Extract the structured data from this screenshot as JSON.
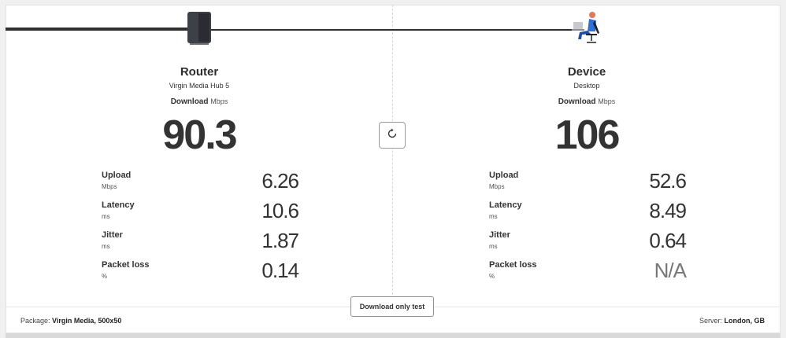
{
  "router": {
    "name": "Router",
    "model": "Virgin Media Hub 5",
    "download_label": "Download",
    "download_unit": "Mbps",
    "download_value": "90.3",
    "metrics": [
      {
        "label": "Upload",
        "unit": "Mbps",
        "value": "6.26"
      },
      {
        "label": "Latency",
        "unit": "ms",
        "value": "10.6"
      },
      {
        "label": "Jitter",
        "unit": "ms",
        "value": "1.87"
      },
      {
        "label": "Packet loss",
        "unit": "%",
        "value": "0.14"
      }
    ]
  },
  "device": {
    "name": "Device",
    "type": "Desktop",
    "download_label": "Download",
    "download_unit": "Mbps",
    "download_value": "106",
    "metrics": [
      {
        "label": "Upload",
        "unit": "Mbps",
        "value": "52.6"
      },
      {
        "label": "Latency",
        "unit": "ms",
        "value": "8.49"
      },
      {
        "label": "Jitter",
        "unit": "ms",
        "value": "0.64"
      },
      {
        "label": "Packet loss",
        "unit": "%",
        "value": "N/A"
      }
    ]
  },
  "actions": {
    "refresh_icon": "refresh-icon",
    "download_only_label": "Download only test"
  },
  "footer": {
    "package_label": "Package:",
    "package_value": "Virgin Media, 500x50",
    "server_label": "Server:",
    "server_value": "London, GB"
  },
  "colors": {
    "text": "#2b2b2b",
    "person_shirt": "#2f6fd6",
    "person_skin": "#e07a5f"
  }
}
